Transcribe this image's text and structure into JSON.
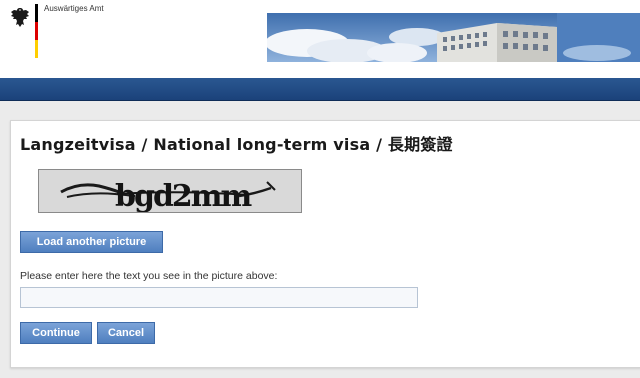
{
  "header": {
    "org_name": "Auswärtiges Amt",
    "flag_colors": [
      "#000000",
      "#dd0000",
      "#ffce00"
    ]
  },
  "main": {
    "title": "Langzeitvisa / National long-term visa / 長期簽證",
    "captcha": {
      "text": "bgd2mm"
    },
    "load_button_label": "Load another picture",
    "prompt_label": "Please enter here the text you see in the picture above:",
    "captcha_input": {
      "value": "",
      "placeholder": ""
    },
    "continue_label": "Continue",
    "cancel_label": "Cancel"
  },
  "colors": {
    "navbar": "#1f4a85",
    "button": "#5f8dcb",
    "background": "#ebebeb"
  }
}
